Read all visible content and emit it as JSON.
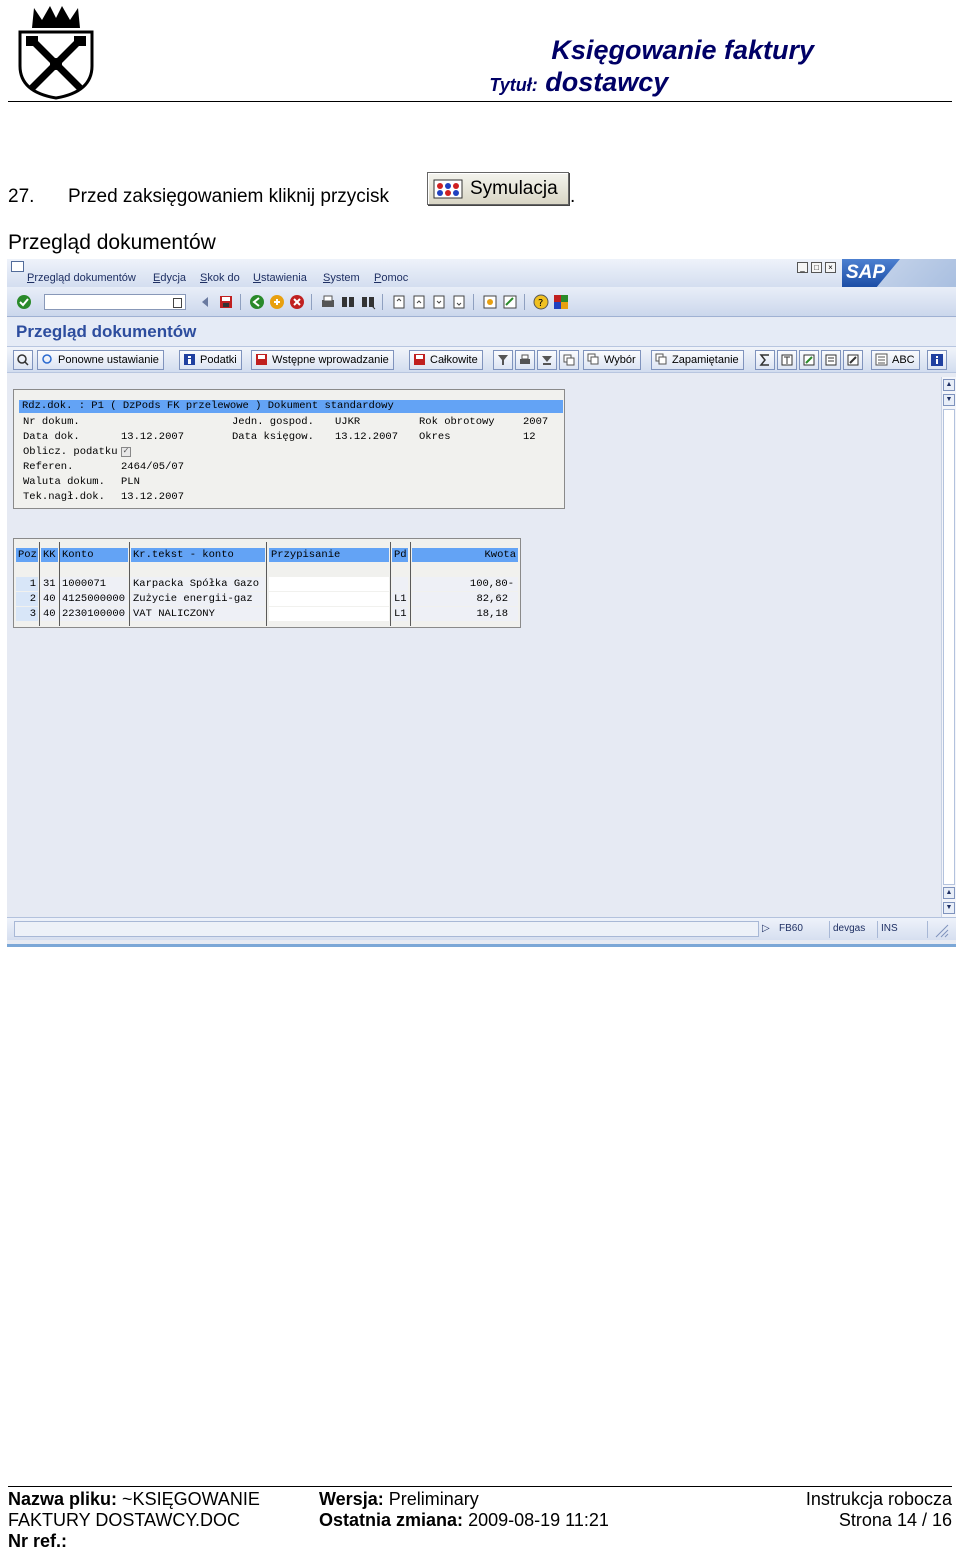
{
  "document": {
    "title_line1": "Księgowanie faktury",
    "title_label": "Tytuł:",
    "title_line2": "dostawcy",
    "step_number": "27.",
    "step_text": "Przed zaksięgowaniem kliknij przycisk",
    "step_button": "Symulacja",
    "step_end": ".",
    "section_title": "Przegląd dokumentów"
  },
  "sap": {
    "menu": [
      "Przegląd dokumentów",
      "Edycja",
      "Skok do",
      "Ustawienia",
      "System",
      "Pomoc"
    ],
    "logo": "SAP",
    "screen_title": "Przegląd dokumentów",
    "app_buttons": [
      "Ponowne ustawianie",
      "Podatki",
      "Wstępne wprowadzanie",
      "Całkowite",
      "Wybór",
      "Zapamiętanie",
      "ABC"
    ],
    "header": {
      "doc_type_line": "Rdz.dok. : P1 ( DzPods FK przelewowe ) Dokument standardowy",
      "nr_label": "Nr dokum.",
      "jedn_label": "Jedn. gospod.",
      "jedn_value": "UJKR",
      "rok_label": "Rok obrotowy",
      "rok_value": "2007",
      "data_label": "Data dok.",
      "data_value": "13.12.2007",
      "dataks_label": "Data księgow.",
      "dataks_value": "13.12.2007",
      "okres_label": "Okres",
      "okres_value": "12",
      "oblicz_label": "Oblicz. podatku",
      "ref_label": "Referen.",
      "ref_value": "2464/05/07",
      "waluta_label": "Waluta dokum.",
      "waluta_value": "PLN",
      "tek_label": "Tek.nagł.dok.",
      "tek_value": "13.12.2007"
    },
    "items": {
      "columns": [
        "Poz",
        "KK",
        "Konto",
        "Kr.tekst - konto",
        "Przypisanie",
        "Pd",
        "Kwota"
      ],
      "rows": [
        {
          "poz": "1",
          "kk": "31",
          "konto": "1000071",
          "tekst": "Karpacka Spółka Gazo",
          "przyp": "",
          "pd": "",
          "kwota": "100,80-"
        },
        {
          "poz": "2",
          "kk": "40",
          "konto": "4125000000",
          "tekst": "Zużycie energii-gaz",
          "przyp": "",
          "pd": "L1",
          "kwota": "82,62"
        },
        {
          "poz": "3",
          "kk": "40",
          "konto": "2230100000",
          "tekst": "VAT NALICZONY",
          "przyp": "",
          "pd": "L1",
          "kwota": "18,18"
        }
      ]
    },
    "status": {
      "transaction": "FB60",
      "user": "devgas",
      "mode": "INS"
    }
  },
  "footer": {
    "file_label": "Nazwa pliku:",
    "file_line1": "~KSIĘGOWANIE",
    "file_line2": "FAKTURY DOSTAWCY.DOC",
    "version_label": "Wersja:",
    "version_value": "Preliminary",
    "changed_label": "Ostatnia zmiana:",
    "changed_value": "2009-08-19 11:21",
    "type_text": "Instrukcja robocza",
    "page_text": "Strona 14 / 16",
    "ref_label": "Nr ref.:"
  },
  "colors": {
    "title_blue": "#000066",
    "sap_title": "#2d4d9e",
    "header_highlight": "#63a3f5"
  }
}
